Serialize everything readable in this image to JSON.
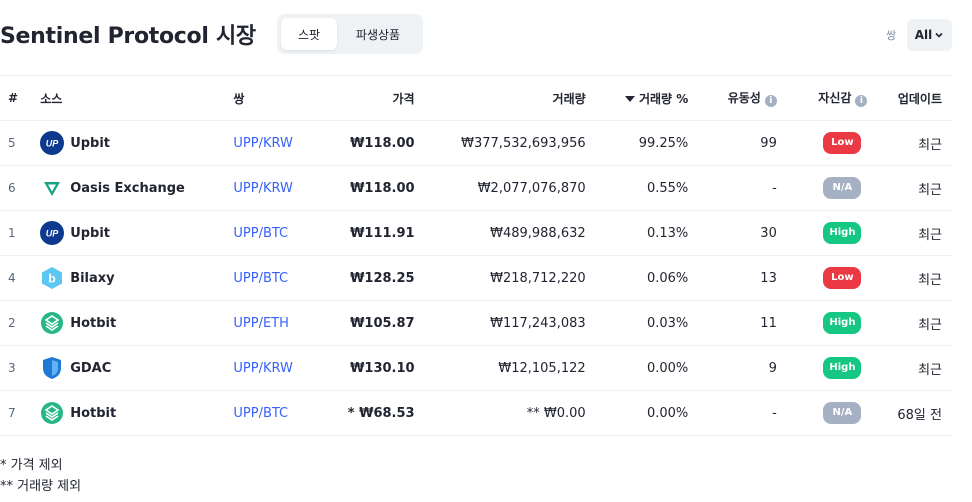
{
  "header": {
    "title": "Sentinel Protocol 시장",
    "tabs": [
      {
        "label": "스팟",
        "active": true
      },
      {
        "label": "파생상품",
        "active": false
      }
    ],
    "pair_filter_label": "쌍",
    "pair_filter_value": "All"
  },
  "table": {
    "columns": {
      "rank": "#",
      "source": "소스",
      "pair": "쌍",
      "price": "가격",
      "volume": "거래량",
      "volume_pct": "거래량 %",
      "liquidity": "유동성",
      "confidence": "자신감",
      "updated": "업데이트"
    },
    "rows": [
      {
        "rank": "5",
        "exchange": "Upbit",
        "logo": "upbit-icon",
        "pair": "UPP/KRW",
        "price": "₩118.00",
        "volume": "₩377,532,693,956",
        "volume_pct": "99.25%",
        "liquidity": "99",
        "confidence": "Low",
        "updated": "최근"
      },
      {
        "rank": "6",
        "exchange": "Oasis Exchange",
        "logo": "oasis-icon",
        "pair": "UPP/KRW",
        "price": "₩118.00",
        "volume": "₩2,077,076,870",
        "volume_pct": "0.55%",
        "liquidity": "-",
        "confidence": "N/A",
        "updated": "최근"
      },
      {
        "rank": "1",
        "exchange": "Upbit",
        "logo": "upbit-icon",
        "pair": "UPP/BTC",
        "price": "₩111.91",
        "volume": "₩489,988,632",
        "volume_pct": "0.13%",
        "liquidity": "30",
        "confidence": "High",
        "updated": "최근"
      },
      {
        "rank": "4",
        "exchange": "Bilaxy",
        "logo": "bilaxy-icon",
        "pair": "UPP/BTC",
        "price": "₩128.25",
        "volume": "₩218,712,220",
        "volume_pct": "0.06%",
        "liquidity": "13",
        "confidence": "Low",
        "updated": "최근"
      },
      {
        "rank": "2",
        "exchange": "Hotbit",
        "logo": "hotbit-icon",
        "pair": "UPP/ETH",
        "price": "₩105.87",
        "volume": "₩117,243,083",
        "volume_pct": "0.03%",
        "liquidity": "11",
        "confidence": "High",
        "updated": "최근"
      },
      {
        "rank": "3",
        "exchange": "GDAC",
        "logo": "gdac-icon",
        "pair": "UPP/KRW",
        "price": "₩130.10",
        "volume": "₩12,105,122",
        "volume_pct": "0.00%",
        "liquidity": "9",
        "confidence": "High",
        "updated": "최근"
      },
      {
        "rank": "7",
        "exchange": "Hotbit",
        "logo": "hotbit-icon",
        "pair": "UPP/BTC",
        "price": "* ₩68.53",
        "volume": "** ₩0.00",
        "volume_pct": "0.00%",
        "liquidity": "-",
        "confidence": "N/A",
        "updated": "68일 전"
      }
    ]
  },
  "footnotes": [
    "* 가격 제외",
    "** 거래량 제외"
  ],
  "colors": {
    "low": "#ea3943",
    "high": "#16c784",
    "na": "#a6b0c3",
    "link": "#3861fb"
  }
}
